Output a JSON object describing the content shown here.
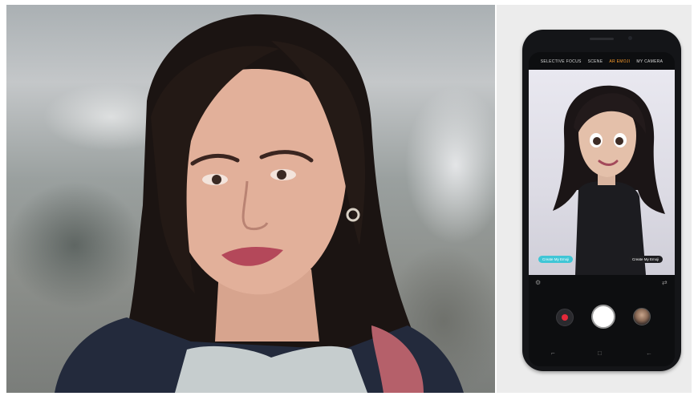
{
  "camera_app": {
    "modes": [
      "SELECTIVE FOCUS",
      "SCENE",
      "AR EMOJI",
      "MY CAMERA"
    ],
    "active_mode": "AR EMOJI",
    "left_pill_label": "Create My Emoji",
    "right_pill_label": "Create My Emoji"
  },
  "colors": {
    "accent": "#ff9e2c",
    "pill_cyan": "#3fc6d6",
    "record": "#e5293a"
  },
  "icons": {
    "settings": "gear-icon",
    "switch_camera": "switch-camera-icon",
    "record": "record-icon",
    "shutter": "shutter-button",
    "gallery": "gallery-thumbnail",
    "recent_apps": "recent-apps-icon",
    "home": "home-icon",
    "back": "back-icon"
  }
}
